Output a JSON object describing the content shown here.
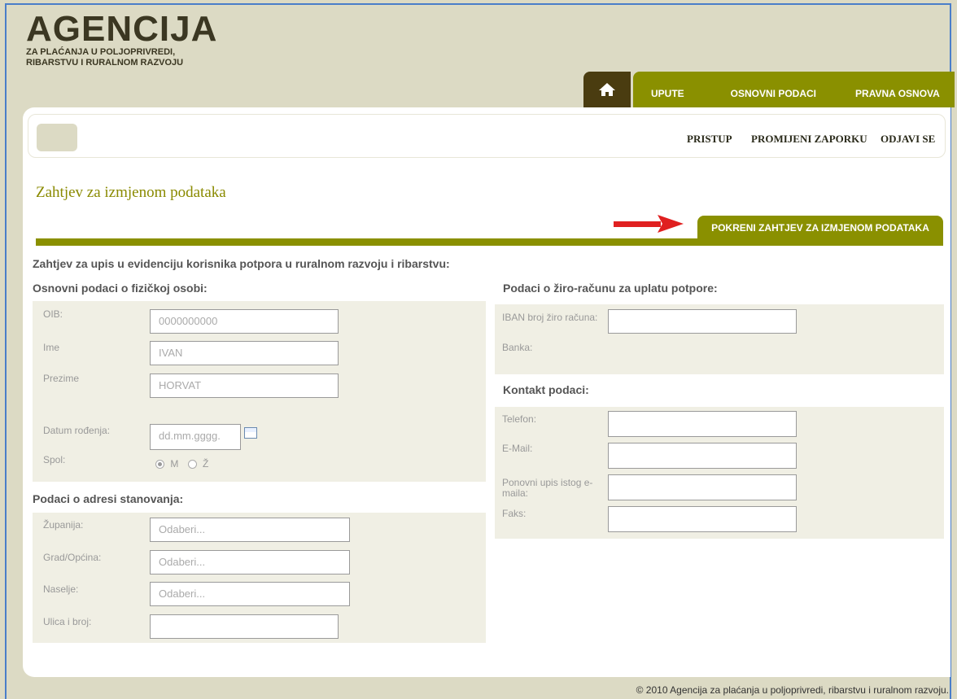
{
  "header": {
    "logo_main": "AGENCIJA",
    "logo_line1": "ZA PLAĆANJA U POLJOPRIVREDI,",
    "logo_line2": "RIBARSTVU I RURALNOM RAZVOJU",
    "nav_items": [
      "UPUTE",
      "OSNOVNI PODACI",
      "PRAVNA OSNOVA"
    ],
    "home_icon": "home-icon"
  },
  "subnav": {
    "links": [
      "PRISTUP",
      "PROMIJENI ZAPORKU",
      "ODJAVI SE"
    ]
  },
  "page": {
    "title": "Zahtjev za izmjenom podataka",
    "action_tab": "POKRENI ZAHTJEV ZA IZMJENOM PODATAKA"
  },
  "form": {
    "title": "Zahtjev za upis u evidenciju korisnika potpora u ruralnom razvoju i ribarstvu:",
    "personal": {
      "heading": "Osnovni podaci o fizičkoj osobi:",
      "oib_label": "OIB:",
      "oib_value": "0000000000",
      "ime_label": "Ime",
      "ime_value": "IVAN",
      "prezime_label": "Prezime",
      "prezime_value": "HORVAT",
      "dob_label": "Datum rođenja:",
      "dob_placeholder": "dd.mm.gggg.",
      "spol_label": "Spol:",
      "spol_m": "M",
      "spol_z": "Ž"
    },
    "address": {
      "heading": "Podaci o adresi stanovanja:",
      "zupanija_label": "Županija:",
      "zupanija_value": "Odaberi...",
      "grad_label": "Grad/Općina:",
      "grad_value": "Odaberi...",
      "naselje_label": "Naselje:",
      "naselje_value": "Odaberi...",
      "ulica_label": "Ulica i broj:",
      "ulica_value": ""
    },
    "bank": {
      "heading": "Podaci o žiro-računu za uplatu potpore:",
      "iban_label": "IBAN broj žiro računa:",
      "iban_value": "",
      "banka_label": "Banka:"
    },
    "contact": {
      "heading": "Kontakt podaci:",
      "telefon_label": "Telefon:",
      "email_label": "E-Mail:",
      "email2_label": "Ponovni upis istog e-maila:",
      "faks_label": "Faks:"
    }
  },
  "footer": {
    "text": "© 2010 Agencija za plaćanja u poljoprivredi, ribarstvu i ruralnom razvoju."
  },
  "colors": {
    "accent": "#8a9000",
    "home_tab": "#4a3c10",
    "background": "#dcdac4",
    "arrow": "#e02020"
  }
}
